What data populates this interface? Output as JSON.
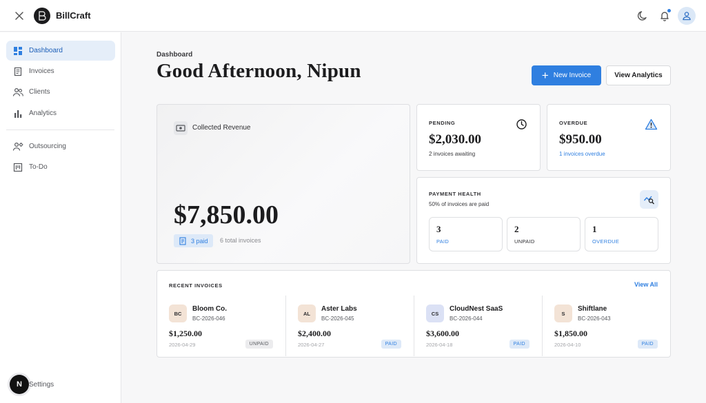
{
  "app": {
    "brand": "BillCraft",
    "logo_glyph": "BC"
  },
  "header": {
    "icons": [
      "close-icon",
      "moon-icon",
      "bell-icon",
      "user-icon"
    ],
    "has_notification": true
  },
  "sidebar": {
    "items": [
      {
        "label": "Dashboard",
        "icon": "dashboard-icon",
        "active": true
      },
      {
        "label": "Invoices",
        "icon": "invoice-icon",
        "active": false
      },
      {
        "label": "Clients",
        "icon": "users-icon",
        "active": false
      },
      {
        "label": "Analytics",
        "icon": "bar-chart-icon",
        "active": false
      },
      {
        "label": "Outsourcing",
        "icon": "outsourcing-icon",
        "active": false
      },
      {
        "label": "To-Do",
        "icon": "todo-icon",
        "active": false
      }
    ],
    "settings": {
      "avatar_letter": "N",
      "label": "Settings"
    }
  },
  "page": {
    "breadcrumb": "Dashboard",
    "greeting": "Good Afternoon, Nipun",
    "new_invoice_label": "New Invoice",
    "view_analytics_label": "View Analytics"
  },
  "revenue": {
    "label": "Collected Revenue",
    "amount": "$7,850.00",
    "paid_badge": "3 paid",
    "total_invoices": "6 total invoices"
  },
  "pending": {
    "label": "PENDING",
    "amount": "$2,030.00",
    "sub": "2 invoices awaiting"
  },
  "overdue": {
    "label": "OVERDUE",
    "amount": "$950.00",
    "sub": "1 invoices overdue"
  },
  "payment_health": {
    "title": "PAYMENT HEALTH",
    "sub": "50% of invoices are paid",
    "boxes": [
      {
        "count": "3",
        "label": "PAID"
      },
      {
        "count": "2",
        "label": "UNPAID"
      },
      {
        "count": "1",
        "label": "OVERDUE"
      }
    ]
  },
  "recent": {
    "title": "RECENT INVOICES",
    "view_all": "View All",
    "invoices": [
      {
        "initials": "BC",
        "name": "Bloom Co.",
        "number": "BC-2026-046",
        "amount": "$1,250.00",
        "date": "2026-04-29",
        "status": "UNPAID",
        "color": "#f3e3d6"
      },
      {
        "initials": "AL",
        "name": "Aster Labs",
        "number": "BC-2026-045",
        "amount": "$2,400.00",
        "date": "2026-04-27",
        "status": "PAID",
        "color": "#f3e3d6"
      },
      {
        "initials": "CS",
        "name": "CloudNest SaaS",
        "number": "BC-2026-044",
        "amount": "$3,600.00",
        "date": "2026-04-18",
        "status": "PAID",
        "color": "#dbe1f5"
      },
      {
        "initials": "S",
        "name": "Shiftlane",
        "number": "BC-2026-043",
        "amount": "$1,850.00",
        "date": "2026-04-10",
        "status": "PAID",
        "color": "#f3e3d6"
      }
    ]
  },
  "colors": {
    "accent": "#2f7fe0",
    "active_bg": "#e5eef9",
    "text": "#1c1c1e"
  }
}
